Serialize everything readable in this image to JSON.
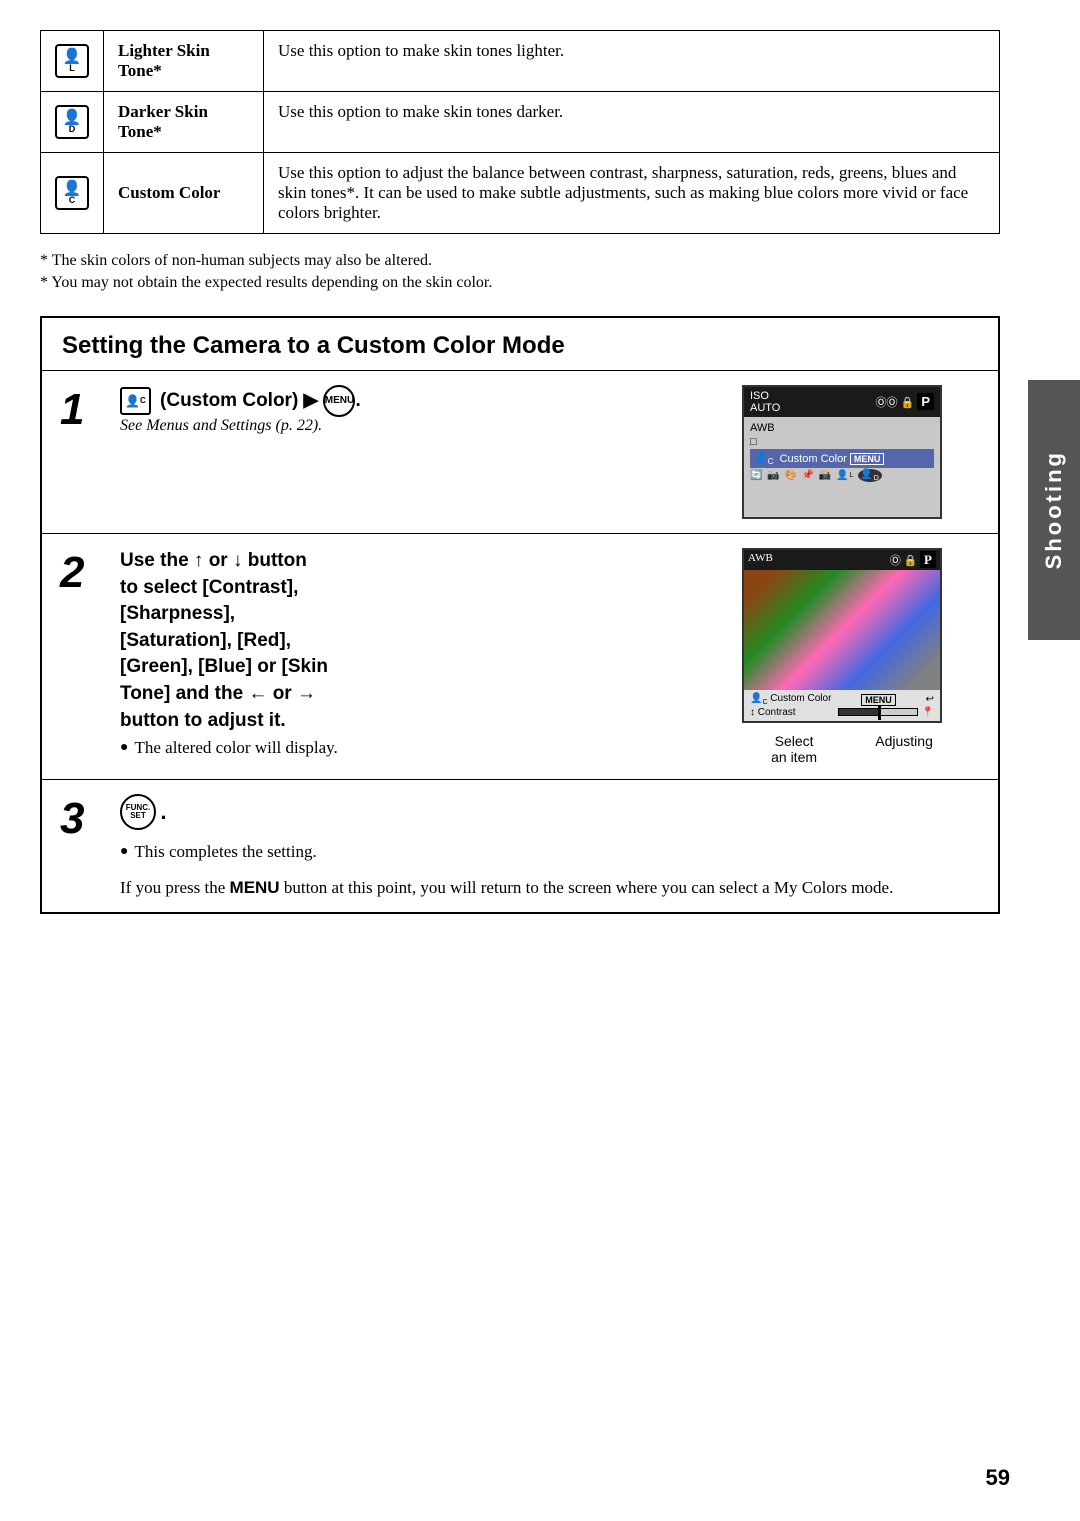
{
  "page": {
    "number": "59",
    "sidebar_label": "Shooting"
  },
  "table": {
    "rows": [
      {
        "icon": "🅻",
        "icon_text": "ᴸ",
        "label": "Lighter Skin Tone*",
        "description": "Use this option to make skin tones lighter."
      },
      {
        "icon": "🅳",
        "icon_text": "ᴰ",
        "label": "Darker Skin Tone*",
        "description": "Use this option to make skin tones darker."
      },
      {
        "icon": "🅲",
        "icon_text": "ᶜ",
        "label": "Custom Color",
        "description": "Use this option to adjust the balance between contrast, sharpness, saturation, reds, greens, blues and skin tones*. It can be used to make subtle adjustments, such as making blue colors more vivid or face colors brighter."
      }
    ],
    "footnotes": [
      "* The skin colors of non-human subjects may also be altered.",
      "* You may not obtain the expected results depending on the skin color."
    ]
  },
  "instruction_box": {
    "title": "Setting the Camera to a Custom Color Mode",
    "steps": [
      {
        "number": "1",
        "instruction_html": "(Custom Color) ▶ ○.",
        "sub_text": "See Menus and Settings (p. 22).",
        "has_image": true,
        "image_type": "menu_screen"
      },
      {
        "number": "2",
        "instruction_html": "Use the ↑ or ↓ button to select [Contrast], [Sharpness], [Saturation], [Red], [Green], [Blue] or [Skin Tone] and the ← or → button to adjust it.",
        "bullet": "The altered color will display.",
        "has_image": true,
        "image_type": "flower_screen",
        "caption_left": "Select an item",
        "caption_right": "Adjusting"
      },
      {
        "number": "3",
        "instruction_icon": "FUNC/SET",
        "bullets": [
          "This completes the setting."
        ],
        "footer_text": "If you press the MENU button at this point, you will return to the screen where you can select a My Colors mode."
      }
    ]
  }
}
